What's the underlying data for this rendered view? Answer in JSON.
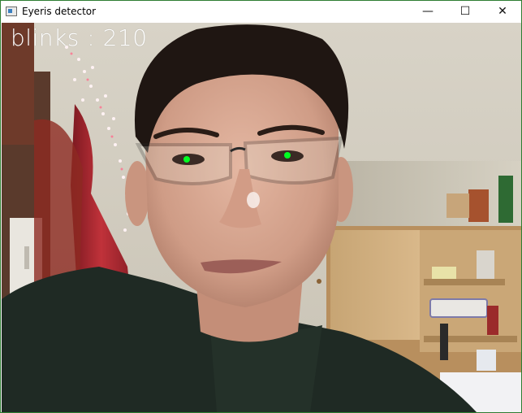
{
  "window": {
    "title": "Eyeris detector",
    "icon": "window-app-icon",
    "controls": {
      "minimize_glyph": "—",
      "maximize_glyph": "☐",
      "close_glyph": "✕"
    }
  },
  "camera": {
    "overlay_text": "blinks : 210",
    "eye_marker_color": "#00ff22",
    "eye_markers": [
      "left-eye-marker",
      "right-eye-marker"
    ]
  },
  "colors": {
    "window_border": "#2e7d32",
    "overlay_text": "#ffffff"
  }
}
